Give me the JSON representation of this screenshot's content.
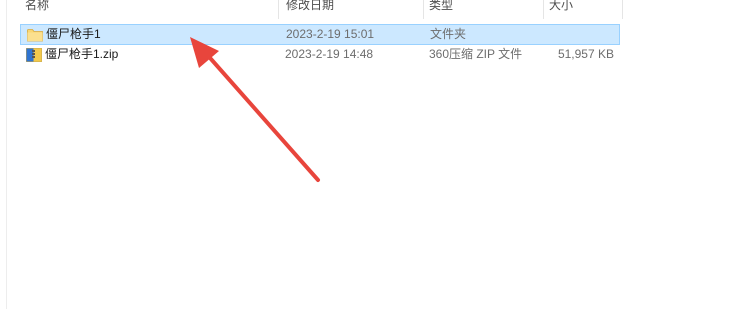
{
  "columns": {
    "name": "名称",
    "modified": "修改日期",
    "type": "类型",
    "size": "大小"
  },
  "files": [
    {
      "name": "僵尸枪手1",
      "modified": "2023-2-19 15:01",
      "type": "文件夹",
      "size": "",
      "icon": "folder-icon",
      "selected": true
    },
    {
      "name": "僵尸枪手1.zip",
      "modified": "2023-2-19 14:48",
      "type": "360压缩 ZIP 文件",
      "size": "51,957 KB",
      "icon": "zip-archive-icon",
      "selected": false
    }
  ],
  "colors": {
    "selection_bg": "#cce8ff",
    "selection_border": "#99d1ff",
    "annotation_arrow": "#e8453c",
    "folder": "#f8d775"
  }
}
